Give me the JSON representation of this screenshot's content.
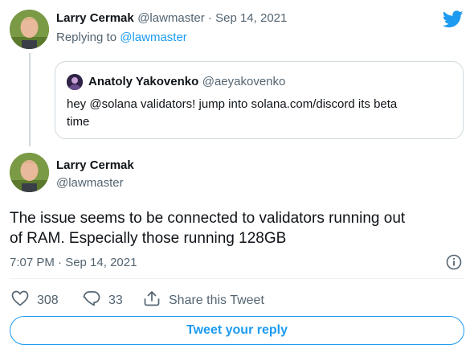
{
  "reply_tweet": {
    "author_name": "Larry Cermak",
    "author_handle": "@lawmaster",
    "date_sep": " · ",
    "date": "Sep 14, 2021",
    "replying_to_prefix": "Replying to ",
    "replying_to_handle": "@lawmaster"
  },
  "quoted_tweet": {
    "author_name": "Anatoly Yakovenko",
    "author_handle": "@aeyakovenko",
    "text_line1": "hey @solana validators!  jump into solana.com/discord its beta",
    "text_line2": "time"
  },
  "main_tweet": {
    "author_name": "Larry Cermak",
    "author_handle": "@lawmaster",
    "text_line1": "The issue seems to be connected to validators running out",
    "text_line2": "of RAM. Especially those running 128GB",
    "timestamp": "7:07 PM · Sep 14, 2021"
  },
  "actions": {
    "likes": "308",
    "replies": "33",
    "share_label": "Share this Tweet"
  },
  "reply_button_label": "Tweet your reply",
  "colors": {
    "accent": "#1d9bf0",
    "text": "#0f1419",
    "muted": "#536471",
    "border": "#cfd9de"
  },
  "icons": [
    "twitter-bird-icon",
    "info-icon",
    "heart-icon",
    "reply-icon",
    "share-icon"
  ]
}
